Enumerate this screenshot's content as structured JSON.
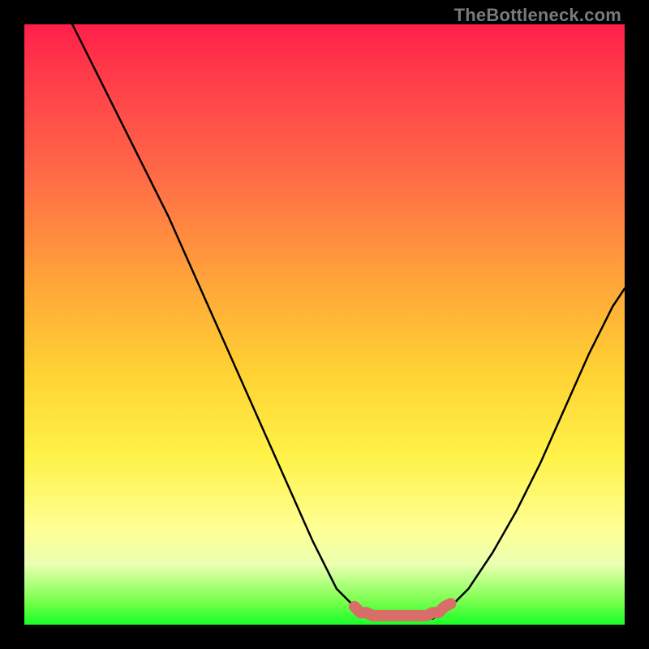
{
  "attribution": "TheBottleneck.com",
  "colors": {
    "background": "#000000",
    "gradient_stops": [
      "#ff1f4b",
      "#ff3a4a",
      "#ff6a47",
      "#ffa23a",
      "#ffd233",
      "#fff249",
      "#ffff95",
      "#eaffb0",
      "#7bff4f",
      "#18ff27"
    ],
    "curve": "#000000",
    "marker": "#d96d67"
  },
  "chart_data": {
    "type": "line",
    "title": "",
    "xlabel": "",
    "ylabel": "",
    "xlim": [
      0,
      100
    ],
    "ylim": [
      0,
      100
    ],
    "series": [
      {
        "name": "left-branch",
        "x": [
          8,
          12,
          16,
          20,
          24,
          28,
          32,
          36,
          40,
          44,
          48,
          52,
          56
        ],
        "y": [
          100,
          92,
          84,
          76,
          68,
          59,
          50,
          41,
          32,
          23,
          14,
          6,
          2
        ]
      },
      {
        "name": "valley-floor",
        "x": [
          56,
          58,
          60,
          62,
          64,
          66,
          68,
          70
        ],
        "y": [
          2,
          1,
          1,
          1,
          1,
          1,
          1,
          2
        ]
      },
      {
        "name": "right-branch",
        "x": [
          70,
          74,
          78,
          82,
          86,
          90,
          94,
          98,
          100
        ],
        "y": [
          2,
          6,
          12,
          19,
          27,
          36,
          45,
          53,
          56
        ]
      }
    ],
    "markers": {
      "name": "valley-band",
      "x": [
        55,
        56,
        57,
        58,
        59,
        60,
        61,
        62,
        63,
        64,
        65,
        66,
        67,
        68,
        69,
        70,
        71
      ],
      "y": [
        3,
        2,
        2,
        1.5,
        1.5,
        1.5,
        1.5,
        1.5,
        1.5,
        1.5,
        1.5,
        1.5,
        1.5,
        2,
        2,
        3,
        3.5
      ]
    },
    "annotations": []
  }
}
